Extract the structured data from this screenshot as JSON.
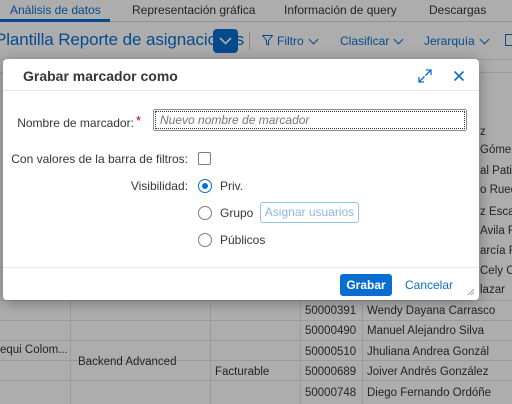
{
  "tabs": [
    {
      "label": "Análisis de datos",
      "active": true
    },
    {
      "label": "Representación gráfica",
      "active": false
    },
    {
      "label": "Información de query",
      "active": false
    },
    {
      "label": "Descargas",
      "active": false
    }
  ],
  "toolbar": {
    "report_title": "Plantilla Reporte de asignaciones",
    "filter_label": "Filtro",
    "sort_label": "Clasificar",
    "hierarchy_label": "Jerarquía"
  },
  "background_table": {
    "visible_right_fragments": [
      "z",
      "Gómez",
      "al Patiñ",
      "o Rued",
      "z Escaz",
      "Avila R",
      "arcía Ro",
      "Cely C",
      "lazar"
    ],
    "left_group": "equi Colom...",
    "service": "Backend Advanced",
    "billing": "Facturable",
    "rows": [
      {
        "id": "50000391",
        "name": "Wendy Dayana Carrasco"
      },
      {
        "id": "50000490",
        "name": "Manuel Alejandro Silva"
      },
      {
        "id": "50000510",
        "name": "Jhuliana Andrea Gonzál"
      },
      {
        "id": "50000689",
        "name": "Joiver Andrés González"
      },
      {
        "id": "50000748",
        "name": "Diego Fernando Ordóñe"
      }
    ]
  },
  "dialog": {
    "title": "Grabar marcador como",
    "name_label": "Nombre de marcador:",
    "required_mark": "*",
    "name_placeholder": "Nuevo nombre de marcador",
    "name_value": "",
    "filter_values_label": "Con valores de la barra de filtros:",
    "filter_values_checked": false,
    "visibility_label": "Visibilidad:",
    "visibility_options": [
      {
        "label": "Priv.",
        "selected": true
      },
      {
        "label": "Grupo",
        "selected": false
      },
      {
        "label": "Públicos",
        "selected": false
      }
    ],
    "assign_users_label": "Asignar usuarios",
    "save_label": "Grabar",
    "cancel_label": "Cancelar"
  },
  "colors": {
    "accent": "#0a6ed1",
    "required": "#bb0000",
    "overlay": "rgba(0,0,0,0.32)"
  }
}
